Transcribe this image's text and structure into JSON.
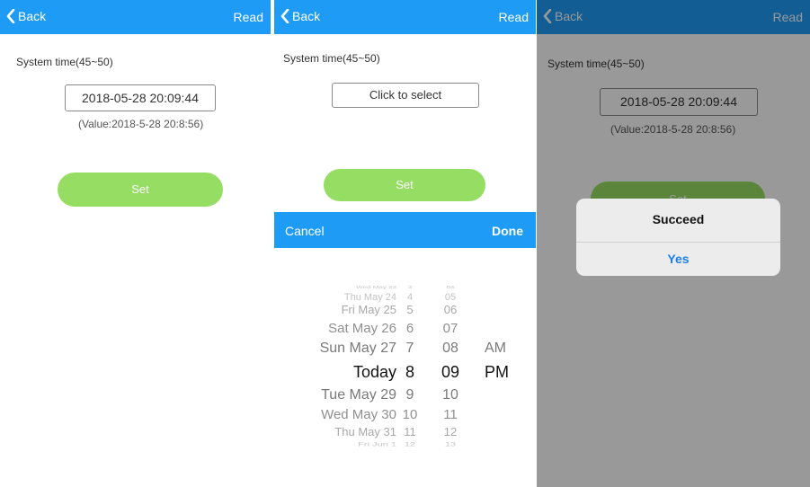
{
  "screens": [
    {
      "nav": {
        "back": "Back",
        "read": "Read"
      },
      "system_label": "System time(45~50)",
      "time_value": "2018-05-28 20:09:44",
      "value_note": "(Value:2018-5-28 20:8:56)",
      "set_label": "Set"
    },
    {
      "nav": {
        "back": "Back",
        "read": "Read"
      },
      "system_label": "System time(45~50)",
      "time_placeholder": "Click to select",
      "set_label": "Set",
      "picker": {
        "cancel": "Cancel",
        "done": "Done",
        "rows": [
          {
            "date": "Wed May 23",
            "hour": "3",
            "minute": "04",
            "ampm": ""
          },
          {
            "date": "Thu May 24",
            "hour": "4",
            "minute": "05",
            "ampm": ""
          },
          {
            "date": "Fri May 25",
            "hour": "5",
            "minute": "06",
            "ampm": ""
          },
          {
            "date": "Sat May 26",
            "hour": "6",
            "minute": "07",
            "ampm": ""
          },
          {
            "date": "Sun May 27",
            "hour": "7",
            "minute": "08",
            "ampm": "AM"
          },
          {
            "date": "Today",
            "hour": "8",
            "minute": "09",
            "ampm": "PM"
          },
          {
            "date": "Tue May 29",
            "hour": "9",
            "minute": "10",
            "ampm": ""
          },
          {
            "date": "Wed May 30",
            "hour": "10",
            "minute": "11",
            "ampm": ""
          },
          {
            "date": "Thu May 31",
            "hour": "11",
            "minute": "12",
            "ampm": ""
          },
          {
            "date": "Fri Jun 1",
            "hour": "12",
            "minute": "13",
            "ampm": ""
          }
        ]
      }
    },
    {
      "nav": {
        "back": "Back",
        "read": "Read"
      },
      "system_label": "System time(45~50)",
      "time_value": "2018-05-28 20:09:44",
      "value_note": "(Value:2018-5-28 20:8:56)",
      "set_label": "Set",
      "dialog": {
        "title": "Succeed",
        "button": "Yes"
      }
    }
  ],
  "colors": {
    "nav_bar": "#1e9cf5",
    "set_button": "#96de63",
    "dialog_button_text": "#1e7fe0"
  },
  "icons": {
    "back": "chevron-left-icon"
  }
}
